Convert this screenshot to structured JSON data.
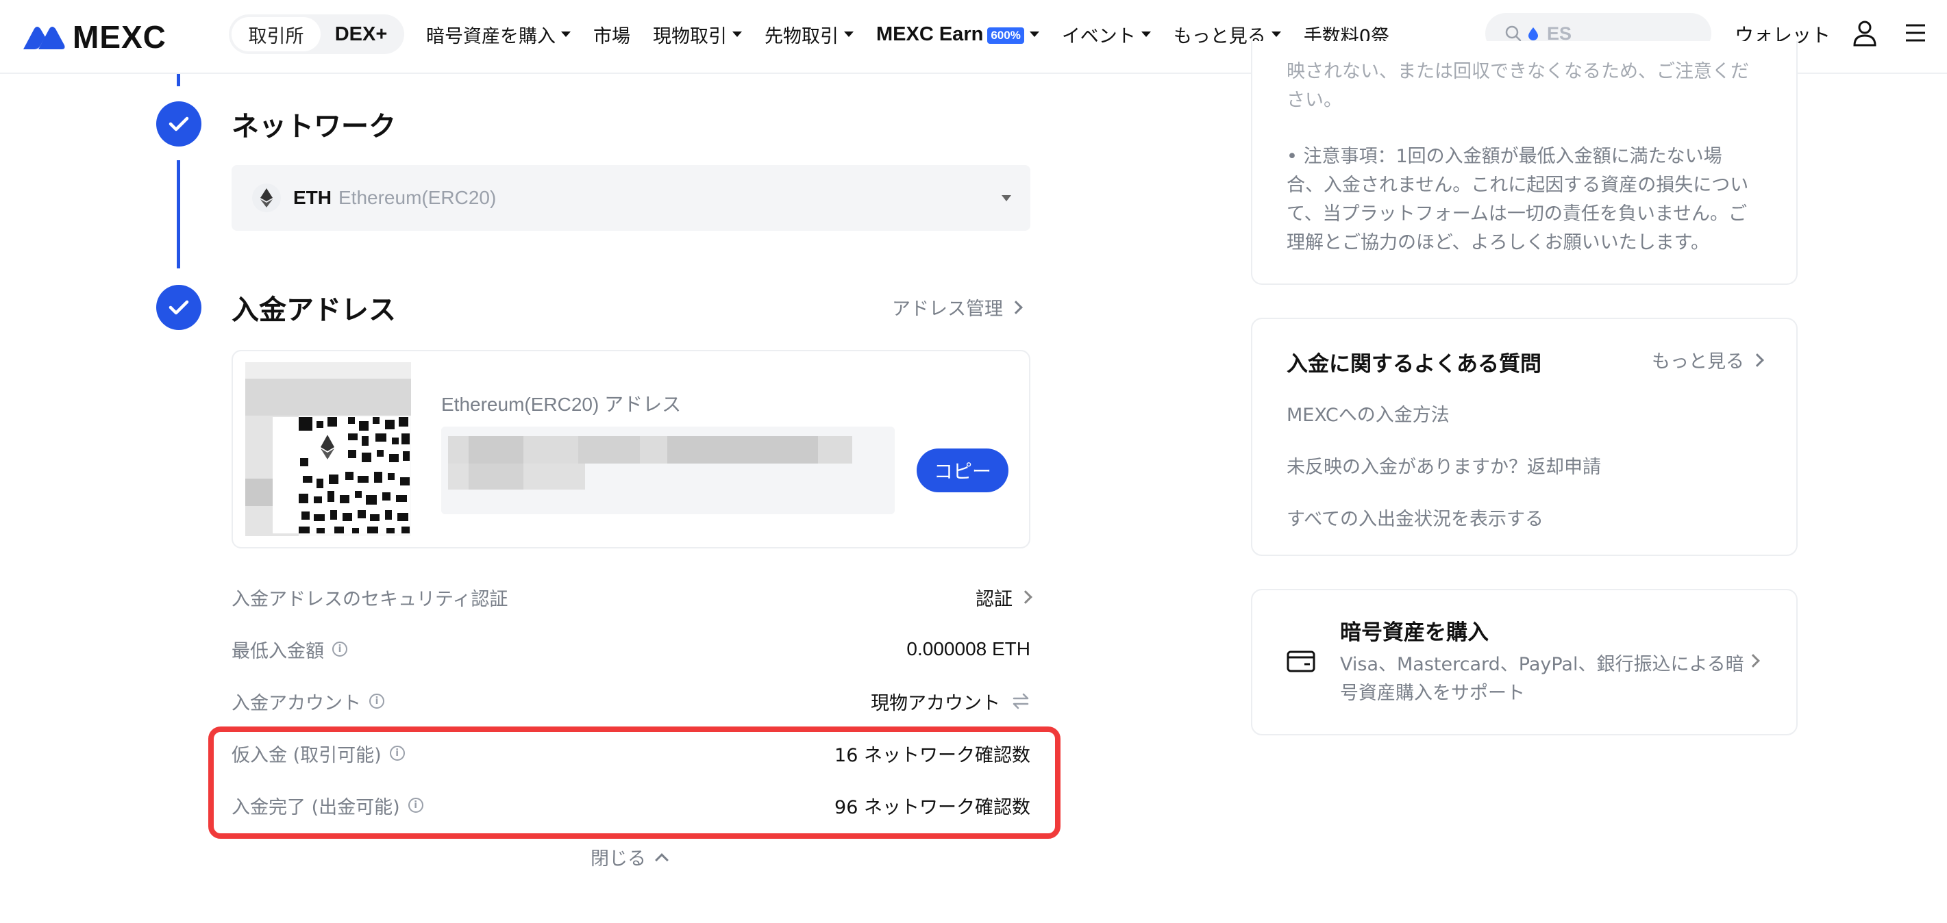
{
  "header": {
    "logo_text": "MEXC",
    "segment": {
      "exchange": "取引所",
      "dex": "DEX+"
    },
    "nav": [
      {
        "label": "暗号資産を購入",
        "dropdown": true
      },
      {
        "label": "市場",
        "dropdown": false
      },
      {
        "label": "現物取引",
        "dropdown": true
      },
      {
        "label": "先物取引",
        "dropdown": true
      },
      {
        "label": "MEXC Earn",
        "badge": "600%",
        "dropdown": true
      },
      {
        "label": "イベント",
        "dropdown": true
      },
      {
        "label": "もっと見る",
        "dropdown": true
      },
      {
        "label": "手数料0祭",
        "dropdown": false
      }
    ],
    "search_placeholder": "ES",
    "wallet_label": "ウォレット"
  },
  "steps": {
    "network": {
      "title": "ネットワーク",
      "selected_code": "ETH",
      "selected_name": "Ethereum(ERC20)"
    },
    "address": {
      "title": "入金アドレス",
      "manage_label": "アドレス管理",
      "address_label": "Ethereum(ERC20) アドレス",
      "copy_label": "コピー"
    }
  },
  "details": [
    {
      "key": "入金アドレスのセキュリティ認証",
      "value": "認証",
      "info": false
    },
    {
      "key": "最低入金額",
      "value": "0.000008 ETH",
      "info": true
    },
    {
      "key": "入金アカウント",
      "value": "現物アカウント",
      "info": true
    },
    {
      "key": "仮入金 (取引可能)",
      "value": "16 ネットワーク確認数",
      "info": true
    },
    {
      "key": "入金完了 (出金可能)",
      "value": "96 ネットワーク確認数",
      "info": true
    }
  ],
  "close_label": "閉じる",
  "notice": {
    "partial_line_1": "映されない、または回収できなくなるため、ご注意くだ",
    "partial_line_2": "さい。",
    "item_lines": [
      "• 注意事項：1回の入金額が最低入金額に満たない場",
      "合、入金されません。これに起因する資産の損失につい",
      "て、当プラットフォームは一切の責任を負いません。ご",
      "理解とご協力のほど、よろしくお願いいたします。"
    ]
  },
  "faq": {
    "title": "入金に関するよくある質問",
    "more_label": "もっと見る",
    "links": [
      "MEXCへの入金方法",
      "未反映の入金がありますか？返却申請",
      "すべての入出金状況を表示する"
    ]
  },
  "buy": {
    "title": "暗号資産を購入",
    "desc_lines": [
      "Visa、Mastercard、PayPal、銀行振込による暗",
      "号資産購入をサポート"
    ]
  },
  "colors": {
    "accent": "#2354e6",
    "highlight": "#f03a3a",
    "muted_text": "#7a808a"
  }
}
